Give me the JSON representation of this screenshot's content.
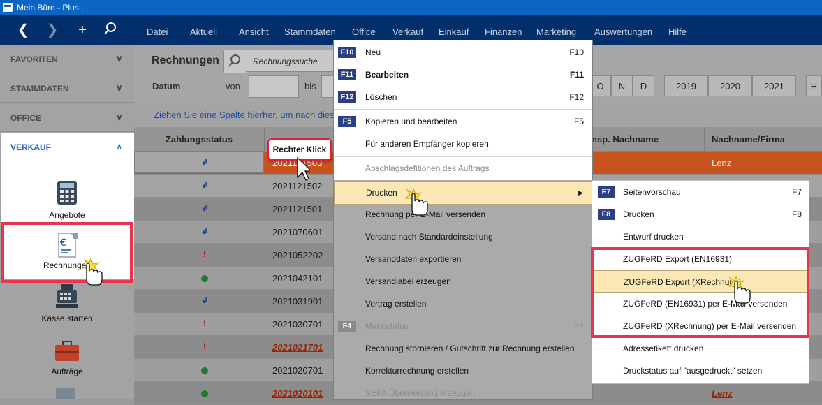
{
  "title": "Mein Büro - Plus |",
  "menu": [
    "Datei",
    "Aktuell",
    "Ansicht",
    "Stammdaten",
    "Office",
    "Verkauf",
    "Einkauf",
    "Finanzen",
    "Marketing",
    "Auswertungen",
    "Hilfe"
  ],
  "sidebar": {
    "sections": [
      "FAVORITEN",
      "STAMMDATEN",
      "OFFICE",
      "VERKAUF"
    ],
    "tools": [
      "Angebote",
      "Rechnungen",
      "Kasse starten",
      "Aufträge"
    ]
  },
  "toolbar": {
    "title": "Rechnungen",
    "search_placeholder": "Rechnungssuche",
    "datum_label": "Datum",
    "von_label": "von",
    "bis_label": "bis",
    "month_buttons": [
      "O",
      "N",
      "D"
    ],
    "year_buttons": [
      "2019",
      "2020",
      "2021"
    ],
    "extra_button": "H"
  },
  "group_hint": "Ziehen Sie eine Spalte hierher, um nach dies",
  "columns": [
    "Zahlungsstatus",
    "nsp. Nachname",
    "Nachname/Firma"
  ],
  "callout": "Rechter Klick",
  "rows": [
    {
      "status": "return",
      "nr": "2021121503",
      "name": "Lenz"
    },
    {
      "status": "return",
      "nr": "2021121502",
      "name": ""
    },
    {
      "status": "return",
      "nr": "2021121501",
      "name": ""
    },
    {
      "status": "return",
      "nr": "2021070601",
      "name": ""
    },
    {
      "status": "excl",
      "nr": "2021052202",
      "name": ""
    },
    {
      "status": "dot",
      "nr": "2021042101",
      "name": ""
    },
    {
      "status": "return",
      "nr": "2021031901",
      "name": ""
    },
    {
      "status": "excl",
      "nr": "2021030701",
      "name": ""
    },
    {
      "status": "excl",
      "nr": "2021021701",
      "name": ""
    },
    {
      "status": "dot",
      "nr": "2021020701",
      "name": ""
    },
    {
      "status": "dot",
      "nr": "2021020101",
      "name": "Lenz"
    }
  ],
  "context_menu": [
    {
      "key": "F10",
      "label": "Neu",
      "shortcut": "F10",
      "enabled": true,
      "bold": false
    },
    {
      "key": "F11",
      "label": "Bearbeiten",
      "shortcut": "F11",
      "enabled": true,
      "bold": true
    },
    {
      "key": "F12",
      "label": "Löschen",
      "shortcut": "F12",
      "enabled": true,
      "bold": false
    },
    {
      "key": "F5",
      "label": "Kopieren und bearbeiten",
      "shortcut": "F5",
      "enabled": true,
      "bold": false
    },
    {
      "key": "",
      "label": "Für anderen Empfänger kopieren",
      "shortcut": "",
      "enabled": true,
      "bold": false
    },
    {
      "key": "",
      "label": "Abschlagsdefitionen des Auftrags",
      "shortcut": "",
      "enabled": false,
      "bold": false
    },
    {
      "key": "",
      "label": "Drucken",
      "shortcut": "",
      "enabled": true,
      "bold": false
    },
    {
      "key": "",
      "label": "Rechnung per E-Mail versenden",
      "shortcut": "",
      "enabled": true,
      "bold": false
    },
    {
      "key": "",
      "label": "Versand nach Standardeinstellung",
      "shortcut": "",
      "enabled": true,
      "bold": false
    },
    {
      "key": "",
      "label": "Versanddaten exportieren",
      "shortcut": "",
      "enabled": true,
      "bold": false
    },
    {
      "key": "",
      "label": "Versandlabel erzeugen",
      "shortcut": "",
      "enabled": true,
      "bold": false
    },
    {
      "key": "",
      "label": "Vertrag erstellen",
      "shortcut": "",
      "enabled": true,
      "bold": false
    },
    {
      "key": "F4",
      "label": "Mahnstatus",
      "shortcut": "F4",
      "enabled": false,
      "bold": false
    },
    {
      "key": "",
      "label": "Rechnung stornieren / Gutschrift zur Rechnung erstellen",
      "shortcut": "",
      "enabled": true,
      "bold": false
    },
    {
      "key": "",
      "label": "Korrekturrechnung erstellen",
      "shortcut": "",
      "enabled": true,
      "bold": false
    },
    {
      "key": "",
      "label": "SEPA Überweisung erzeugen",
      "shortcut": "",
      "enabled": false,
      "bold": false
    }
  ],
  "submenu": [
    {
      "key": "F7",
      "label": "Seitenvorschau",
      "shortcut": "F7"
    },
    {
      "key": "F8",
      "label": "Drucken",
      "shortcut": "F8"
    },
    {
      "key": "",
      "label": "Entwurf drucken",
      "shortcut": ""
    },
    {
      "key": "",
      "label": "ZUGFeRD Export (EN16931)",
      "shortcut": ""
    },
    {
      "key": "",
      "label": "ZUGFeRD Export (XRechnung)",
      "shortcut": ""
    },
    {
      "key": "",
      "label": "ZUGFeRD (EN16931) per E-Mail versenden",
      "shortcut": ""
    },
    {
      "key": "",
      "label": "ZUGFeRD (XRechnung) per E-Mail versenden",
      "shortcut": ""
    },
    {
      "key": "",
      "label": "Adressetikett drucken",
      "shortcut": ""
    },
    {
      "key": "",
      "label": "Druckstatus auf \"ausgedruckt\" setzen",
      "shortcut": ""
    }
  ],
  "colors": {
    "accent": "#0b66c3",
    "menubar": "#002f6c",
    "selected_row": "#c8531d",
    "highlight_red": "#e8344d",
    "hover": "#fbe8b5"
  }
}
